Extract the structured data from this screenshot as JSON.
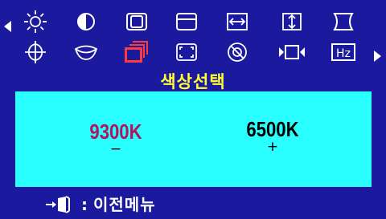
{
  "menu": {
    "title": "색상선택",
    "row1_icons": [
      "brightness-icon",
      "contrast-icon",
      "h-position-icon",
      "v-position-icon",
      "h-size-icon",
      "v-size-icon",
      "pincushion-icon"
    ],
    "row2_icons": [
      "trapezoid-icon",
      "parallelogram-icon",
      "color-select-icon",
      "zoom-icon",
      "degauss-icon",
      "moire-icon",
      "frequency-icon"
    ],
    "selected": "color-select-icon",
    "frequency_label": "Hz"
  },
  "panel": {
    "options": [
      {
        "label": "9300K",
        "sign": "−",
        "selected": true
      },
      {
        "label": "6500K",
        "sign": "+",
        "selected": false
      }
    ]
  },
  "footer": {
    "prefix": ":",
    "label": "이전메뉴"
  },
  "colors": {
    "background": "#1b1a9e",
    "panel": "#2affff",
    "title": "#ffff33",
    "selected_option": "#b0145e",
    "selected_icon": "#ff3b3b"
  }
}
